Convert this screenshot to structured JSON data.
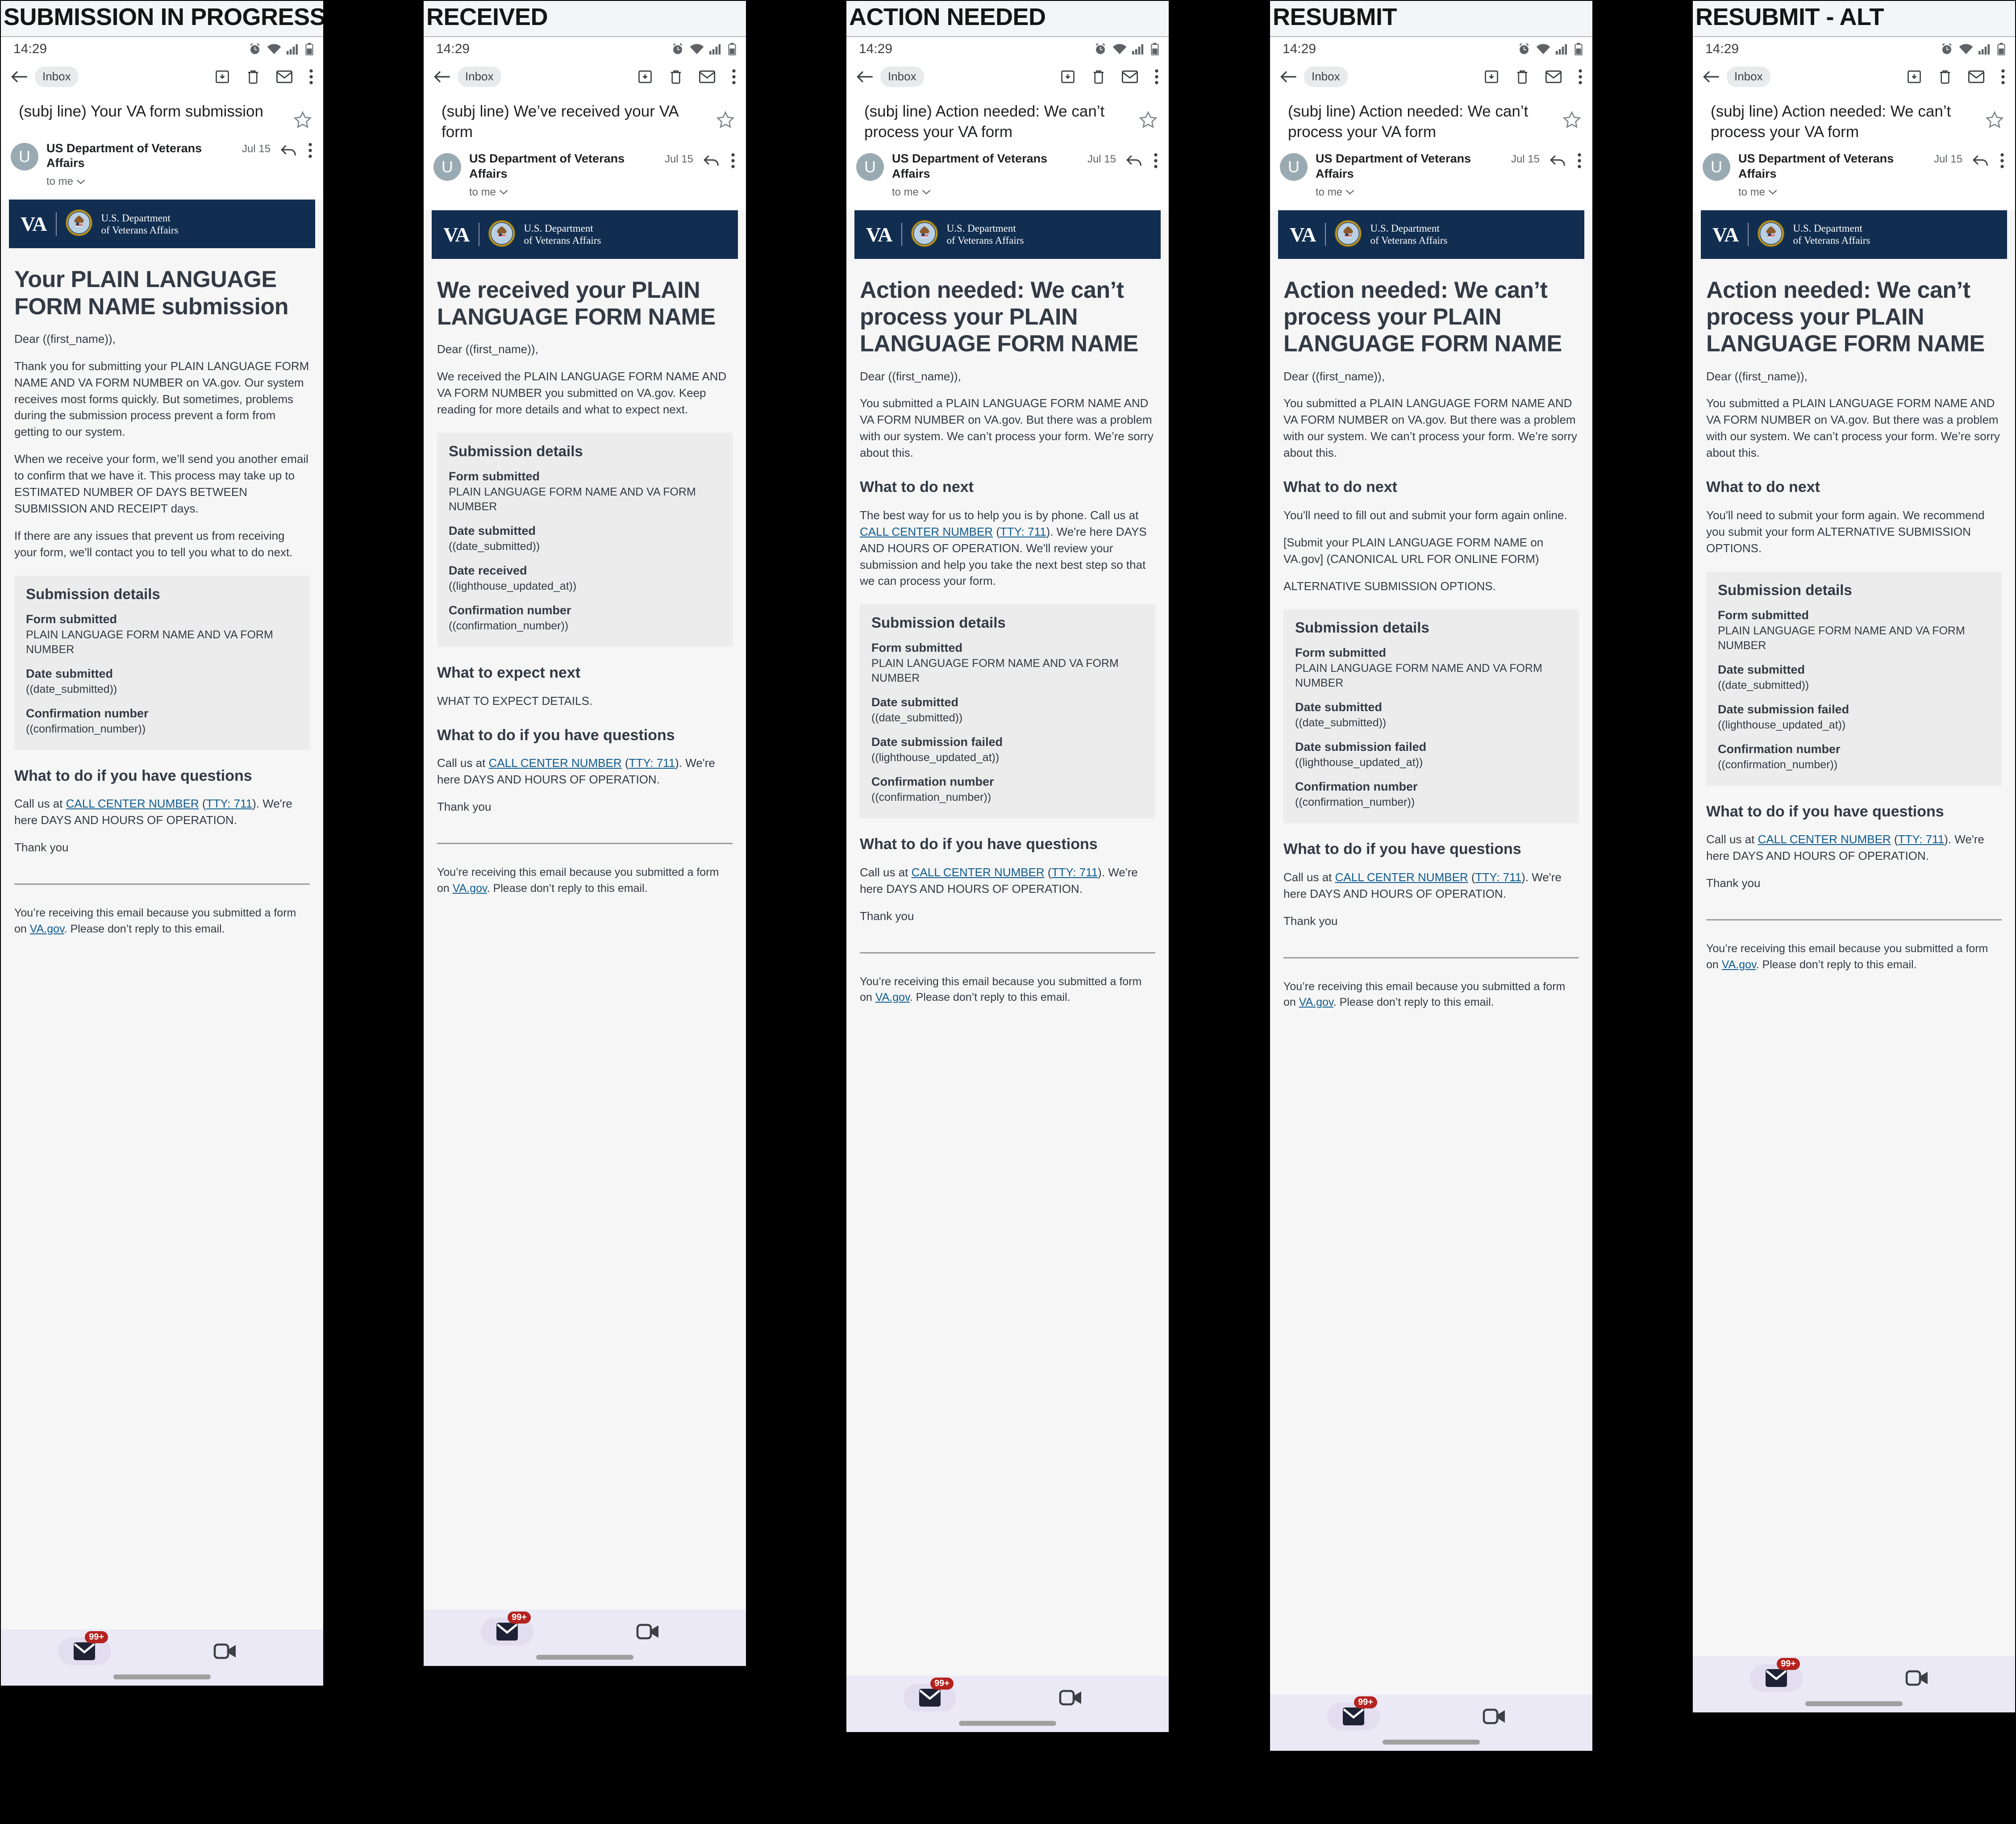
{
  "colors": {
    "va_navy": "#112e51",
    "body_text": "#323a45",
    "link": "#0f5b8e",
    "badge_red": "#b4231e",
    "nav_lavender": "#ebe9f5",
    "card_gray": "#ececec"
  },
  "common": {
    "status_time": "14:29",
    "inbox_chip": "Inbox",
    "avatar_initial": "U",
    "sender_name": "US Department of Veterans Affairs",
    "sender_date": "Jul 15",
    "sender_to": "to me",
    "va_wordmark": "VA",
    "va_dept_line1": "U.S. Department",
    "va_dept_line2": "of Veterans Affairs",
    "salutation": "Dear ((first_name)),",
    "thank_you": "Thank you",
    "footer_text_a": "You’re receiving this email because you submitted a form on ",
    "footer_link": "VA.gov",
    "footer_text_b": ". Please don’t reply to this email.",
    "questions_heading": "What to do if you have questions",
    "call_prefix": "Call us at ",
    "call_center_link": "CALL CENTER NUMBER",
    "tty_open": " (",
    "tty_link": "TTY: 711",
    "call_suffix": "). We're here DAYS AND HOURS OF OPERATION.",
    "details_heading": "Submission details",
    "label_form_submitted": "Form submitted",
    "value_form_submitted": "PLAIN LANGUAGE FORM NAME AND VA FORM NUMBER",
    "label_date_submitted": "Date submitted",
    "value_date_submitted": "((date_submitted))",
    "label_date_received": "Date received",
    "value_date_received": "((lighthouse_updated_at))",
    "label_date_failed": "Date submission failed",
    "value_date_failed": "((lighthouse_updated_at))",
    "label_confirmation": "Confirmation number",
    "value_confirmation": "((confirmation_number))",
    "nav_badge": "99+"
  },
  "panels": [
    {
      "label": "SUBMISSION IN PROGRESS",
      "subject": "(subj line) Your VA form submission",
      "h1": "Your PLAIN LANGUAGE FORM NAME submission",
      "paragraphs": [
        "Thank you for submitting your PLAIN LANGUAGE FORM NAME AND VA FORM NUMBER on VA.gov. Our system receives most forms quickly. But sometimes, problems during the submission process prevent a form from getting to our system.",
        "When we receive your form, we’ll send you another email to confirm that we have it. This process may take up to ESTIMATED NUMBER OF DAYS BETWEEN SUBMISSION AND RECEIPT days.",
        "If there are any issues that prevent us from receiving your form, we'll contact you to tell you what to do next."
      ]
    },
    {
      "label": "RECEIVED",
      "subject": "(subj line) We’ve received your VA form",
      "h1": "We received your PLAIN LANGUAGE FORM NAME",
      "paragraphs": [
        "We received the PLAIN LANGUAGE FORM NAME AND VA FORM NUMBER you submitted on VA.gov. Keep reading for more details and what to expect next."
      ],
      "expect_heading": "What to expect next",
      "expect_body": "WHAT TO EXPECT DETAILS."
    },
    {
      "label": "ACTION NEEDED",
      "subject": "(subj line) Action needed: We can’t process your VA form",
      "h1": "Action needed: We can’t process your PLAIN LANGUAGE FORM NAME",
      "paragraphs": [
        "You submitted a PLAIN LANGUAGE FORM NAME AND VA FORM NUMBER on VA.gov. But there was a problem with our system. We can’t process your form. We’re sorry about this."
      ],
      "next_heading": "What to do next",
      "next_intro_a": "The best way for us to help you is by phone. Call us at ",
      "next_intro_b": "). We're here DAYS AND HOURS OF OPERATION. We'll review your submission and help you take the next best step so that we can process your form."
    },
    {
      "label": "RESUBMIT",
      "subject": "(subj line) Action needed: We can’t process your VA form",
      "h1": "Action needed: We can’t process your PLAIN LANGUAGE FORM NAME",
      "paragraphs": [
        "You submitted a PLAIN LANGUAGE FORM NAME AND VA FORM NUMBER on VA.gov. But there was a problem with our system. We can’t process your form. We’re sorry about this."
      ],
      "next_heading": "What to do next",
      "next_lines": [
        "You'll need to fill out and submit your form again online.",
        "[Submit your PLAIN LANGUAGE FORM NAME on VA.gov] (CANONICAL URL FOR ONLINE FORM)",
        "ALTERNATIVE SUBMISSION OPTIONS."
      ]
    },
    {
      "label": "RESUBMIT - ALT",
      "subject": "(subj line) Action needed: We can’t process your VA form",
      "h1": "Action needed: We can’t process your PLAIN LANGUAGE FORM NAME",
      "paragraphs": [
        "You submitted a PLAIN LANGUAGE FORM NAME AND VA FORM NUMBER on VA.gov. But there was a problem with our system. We can’t process your form. We’re sorry about this."
      ],
      "next_heading": "What to do next",
      "next_lines": [
        "You'll need to submit your form again. We recommend you submit your form ALTERNATIVE SUBMISSION OPTIONS."
      ]
    }
  ]
}
